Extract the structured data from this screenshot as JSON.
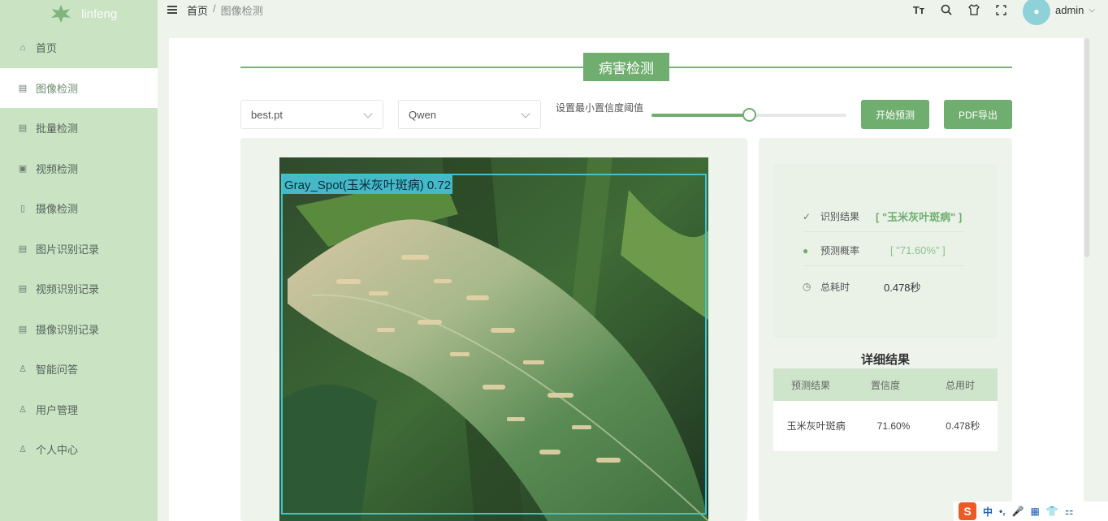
{
  "app": {
    "name": "linfeng"
  },
  "colors": {
    "accent": "#6fae6f",
    "sidebar": "#c9e3c3",
    "bbox": "#3fc3d0"
  },
  "sidebar": {
    "items": [
      {
        "label": "首页",
        "icon": "home-icon"
      },
      {
        "label": "图像检测",
        "icon": "image-icon",
        "active": true
      },
      {
        "label": "批量检测",
        "icon": "batch-icon"
      },
      {
        "label": "视频检测",
        "icon": "video-icon"
      },
      {
        "label": "摄像检测",
        "icon": "camera-icon"
      },
      {
        "label": "图片识别记录",
        "icon": "record-icon"
      },
      {
        "label": "视频识别记录",
        "icon": "record-icon"
      },
      {
        "label": "摄像识别记录",
        "icon": "record-icon"
      },
      {
        "label": "智能问答",
        "icon": "user-icon"
      },
      {
        "label": "用户管理",
        "icon": "user-icon"
      },
      {
        "label": "个人中心",
        "icon": "user-icon"
      }
    ]
  },
  "header": {
    "breadcrumb_home": "首页",
    "breadcrumb_sep": "/",
    "breadcrumb_current": "图像检测",
    "user": "admin",
    "tools": [
      {
        "icon": "font-size-icon",
        "glyph": "Tт"
      },
      {
        "icon": "search-icon",
        "glyph": "Q"
      },
      {
        "icon": "theme-icon",
        "glyph": "♈"
      },
      {
        "icon": "fullscreen-icon",
        "glyph": "⛶"
      }
    ]
  },
  "main": {
    "title": "病害检测",
    "model_select": "best.pt",
    "llm_select": "Qwen",
    "slider_label": "设置最小置信度阈值",
    "confidence_threshold": 0.5,
    "start_button": "开始预测",
    "pdf_button": "PDF导出"
  },
  "detection": {
    "label": "Gray_Spot(玉米灰叶斑病) 0.72"
  },
  "result": {
    "recognition_label": "识别结果",
    "recognition_value": "[ \"玉米灰叶斑病\" ]",
    "probability_label": "预测概率",
    "probability_value": "[ \"71.60%\" ]",
    "time_label": "总耗时",
    "time_value": "0.478秒",
    "detail_title": "详细结果",
    "table": {
      "headers": [
        "预测结果",
        "置信度",
        "总用时"
      ],
      "rows": [
        [
          "玉米灰叶斑病",
          "71.60%",
          "0.478秒"
        ]
      ]
    }
  },
  "ime": {
    "items": [
      "中",
      "•,",
      "🎤",
      "▦",
      "👕",
      "⚏"
    ]
  }
}
